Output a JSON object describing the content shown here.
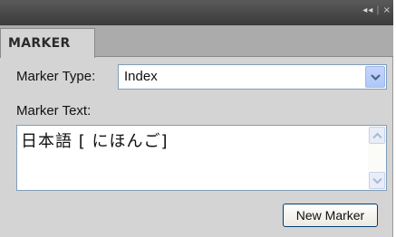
{
  "panel": {
    "controls": {
      "collapse": "◂◂",
      "close": "×"
    },
    "tab": {
      "label": "MARKER"
    }
  },
  "marker_type": {
    "label": "Marker Type:",
    "selected": "Index"
  },
  "marker_text": {
    "label": "Marker Text:",
    "value": "日本語 [ にほんご]"
  },
  "actions": {
    "new_marker_label": "New Marker"
  },
  "colors": {
    "titlebar": "#4a4a4a",
    "panel_bg": "#d4d4d4",
    "tab_strip": "#ababab",
    "input_border": "#7f9db9",
    "dropdown_arrow_bg": "#c3d4fd"
  }
}
